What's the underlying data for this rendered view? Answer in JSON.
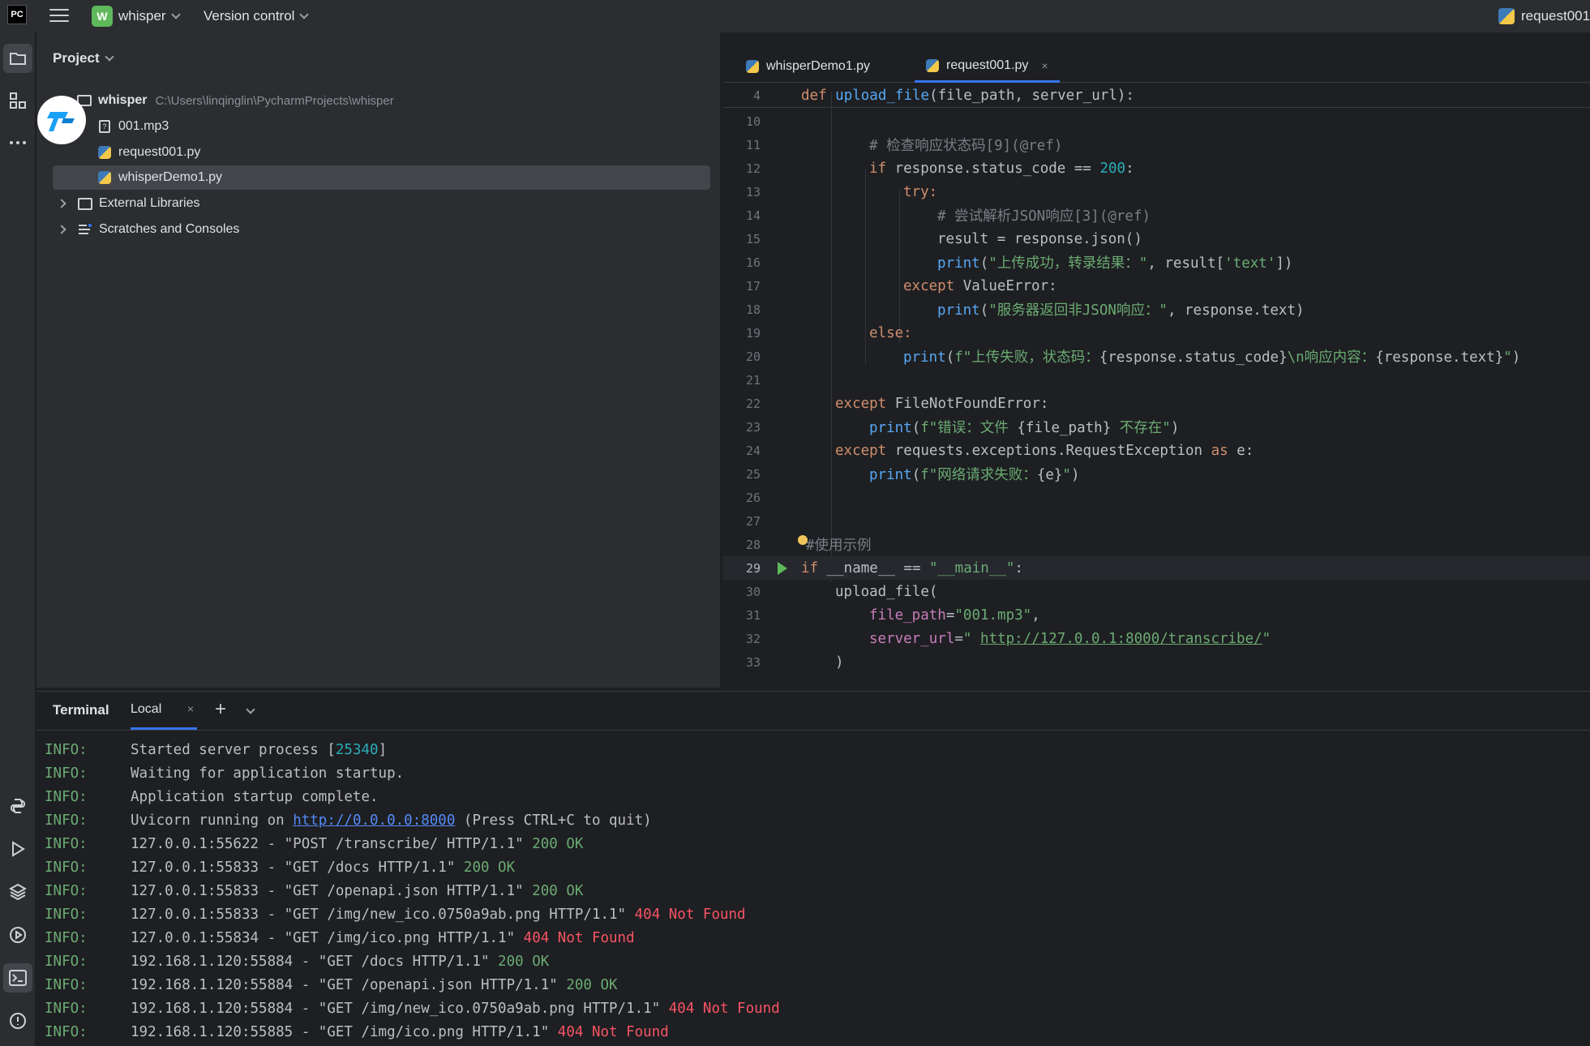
{
  "topbar": {
    "app_logo": "PC",
    "project_badge": "W",
    "project_name": "whisper",
    "vcs_label": "Version control",
    "run_config": "request001"
  },
  "project_panel": {
    "title": "Project",
    "root": {
      "name": "whisper",
      "path": "C:\\Users\\linqinglin\\PycharmProjects\\whisper"
    },
    "files": [
      "001.mp3",
      "request001.py",
      "whisperDemo1.py"
    ],
    "selected_file": "whisperDemo1.py",
    "external_libraries": "External Libraries",
    "scratches": "Scratches and Consoles"
  },
  "editor": {
    "tabs": [
      {
        "label": "whisperDemo1.py",
        "active": false
      },
      {
        "label": "request001.py",
        "active": true,
        "close": "×"
      }
    ],
    "sticky_line": {
      "num": "4",
      "text": "def upload_file(file_path, server_url):"
    },
    "lines": [
      {
        "num": "10"
      },
      {
        "num": "11",
        "text": "# 检查响应状态码[9](@ref)"
      },
      {
        "num": "12",
        "text": "if response.status_code == 200:"
      },
      {
        "num": "13",
        "text": "try:"
      },
      {
        "num": "14",
        "text": "# 尝试解析JSON响应[3](@ref)"
      },
      {
        "num": "15",
        "text": "result = response.json()"
      },
      {
        "num": "16",
        "text": "print(\"上传成功，转录结果：\", result['text'])"
      },
      {
        "num": "17",
        "text": "except ValueError:"
      },
      {
        "num": "18",
        "text": "print(\"服务器返回非JSON响应：\", response.text)"
      },
      {
        "num": "19",
        "text": "else:"
      },
      {
        "num": "20",
        "text": "print(f\"上传失败，状态码：{response.status_code}\\n响应内容：{response.text}\")"
      },
      {
        "num": "21"
      },
      {
        "num": "22",
        "text": "except FileNotFoundError:"
      },
      {
        "num": "23",
        "text": "print(f\"错误：文件 {file_path} 不存在\")"
      },
      {
        "num": "24",
        "text": "except requests.exceptions.RequestException as e:"
      },
      {
        "num": "25",
        "text": "print(f\"网络请求失败：{e}\")"
      },
      {
        "num": "26"
      },
      {
        "num": "27"
      },
      {
        "num": "28",
        "text": "#使用示例"
      },
      {
        "num": "29",
        "text": "if __name__ == \"__main__\":"
      },
      {
        "num": "30",
        "text": "upload_file("
      },
      {
        "num": "31",
        "text": "file_path=\"001.mp3\","
      },
      {
        "num": "32",
        "text": "server_url=\" http://127.0.0.1:8000/transcribe/\""
      },
      {
        "num": "33",
        "text": ")"
      }
    ]
  },
  "terminal": {
    "title": "Terminal",
    "tab": "Local",
    "close": "×",
    "new_tab": "+",
    "lines": [
      {
        "level": "INFO:",
        "msg": "Started server process [",
        "pid": "25340",
        "tail": "]"
      },
      {
        "level": "INFO:",
        "msg": "Waiting for application startup."
      },
      {
        "level": "INFO:",
        "msg": "Application startup complete."
      },
      {
        "level": "INFO:",
        "msg": "Uvicorn running on ",
        "link": "http://0.0.0.0:8000",
        "tail": " (Press CTRL+C to quit)"
      },
      {
        "level": "INFO:",
        "msg": "127.0.0.1:55622 - \"POST /transcribe/ HTTP/1.1\" ",
        "status": "200 OK",
        "ok": true
      },
      {
        "level": "INFO:",
        "msg": "127.0.0.1:55833 - \"GET /docs HTTP/1.1\" ",
        "status": "200 OK",
        "ok": true
      },
      {
        "level": "INFO:",
        "msg": "127.0.0.1:55833 - \"GET /openapi.json HTTP/1.1\" ",
        "status": "200 OK",
        "ok": true
      },
      {
        "level": "INFO:",
        "msg": "127.0.0.1:55833 - \"GET /img/new_ico.0750a9ab.png HTTP/1.1\" ",
        "status": "404 Not Found",
        "ok": false
      },
      {
        "level": "INFO:",
        "msg": "127.0.0.1:55834 - \"GET /img/ico.png HTTP/1.1\" ",
        "status": "404 Not Found",
        "ok": false
      },
      {
        "level": "INFO:",
        "msg": "192.168.1.120:55884 - \"GET /docs HTTP/1.1\" ",
        "status": "200 OK",
        "ok": true
      },
      {
        "level": "INFO:",
        "msg": "192.168.1.120:55884 - \"GET /openapi.json HTTP/1.1\" ",
        "status": "200 OK",
        "ok": true
      },
      {
        "level": "INFO:",
        "msg": "192.168.1.120:55884 - \"GET /img/new_ico.0750a9ab.png HTTP/1.1\" ",
        "status": "404 Not Found",
        "ok": false
      },
      {
        "level": "INFO:",
        "msg": "192.168.1.120:55885 - \"GET /img/ico.png HTTP/1.1\" ",
        "status": "404 Not Found",
        "ok": false
      }
    ]
  },
  "colors": {
    "accent": "#3574f0",
    "ok": "#6aab73",
    "error": "#f75464"
  },
  "icons": [
    "folder-icon",
    "structure-icon",
    "more-icon",
    "python-console-icon",
    "run-icon",
    "layers-icon",
    "services-icon",
    "terminal-icon",
    "problems-icon"
  ]
}
